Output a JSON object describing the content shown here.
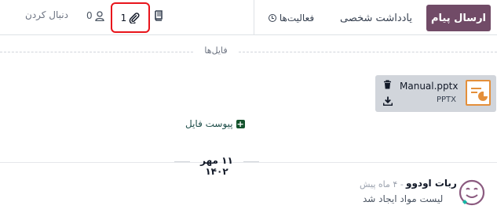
{
  "composer": {
    "send_message_label": "ارسال پیام",
    "log_note_label": "یادداشت شخصی",
    "activities_label": "فعالیت‌ها",
    "attachment_count": "1",
    "follower_count": "0",
    "follow_label": "دنبال کردن"
  },
  "files": {
    "section_label": "فایل‌ها",
    "items": [
      {
        "name": "Manual.pptx",
        "extension": "PPTX"
      }
    ],
    "attach_label": "پیوست فایل"
  },
  "thread": {
    "date_separator": "۱۱ مهر ۱۴۰۲",
    "messages": [
      {
        "author": "ربات اودوو",
        "time": "- ۴ ماه پیش",
        "body": "لیست مواد ایجاد شد"
      }
    ]
  },
  "icons": {
    "activities": "clock-icon",
    "book": "book-icon",
    "attachment": "paperclip-icon",
    "follower": "person-icon",
    "delete": "trash-icon",
    "download": "download-icon",
    "attach": "plus-square-icon",
    "file_type": "presentation-file-icon",
    "avatar": "odoobot-avatar"
  },
  "colors": {
    "primary": "#714b67",
    "highlight": "#e8141b",
    "file_icon_accent": "#e48f3a",
    "attach_link": "#14532d"
  }
}
